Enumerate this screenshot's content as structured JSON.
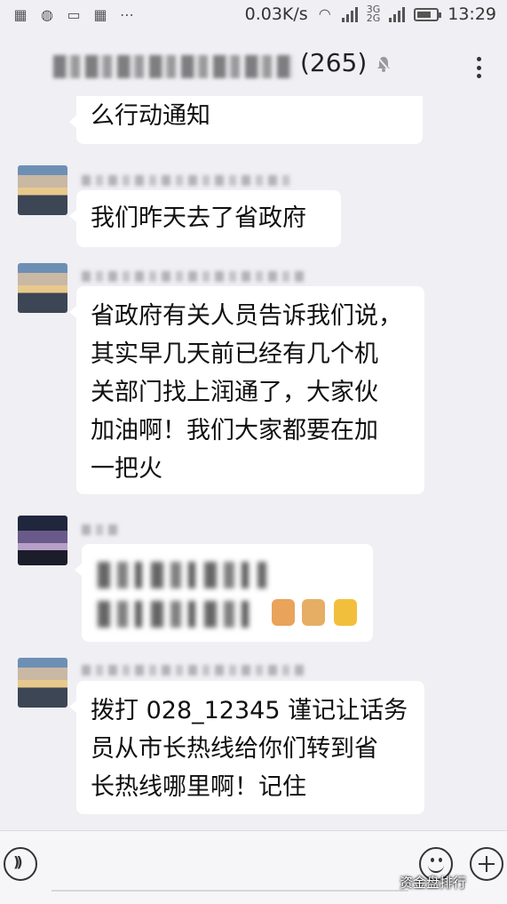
{
  "status_bar": {
    "net_speed": "0.03K/s",
    "network_type": "3G\n2G",
    "time": "13:29",
    "battery_level": 0.75
  },
  "header": {
    "group_member_count": "(265)"
  },
  "messages": [
    {
      "text": "么行动通知"
    },
    {
      "text": "我们昨天去了省政府"
    },
    {
      "lines": [
        "省政府有关人员告诉我们说，",
        "其实早几天前已经有几个机",
        "关部门找上润通了，大家伙",
        "加油啊！我们大家都要在加",
        "一把火"
      ]
    },
    {
      "text": ""
    },
    {
      "lines": [
        "拨打 028_12345 谨记让话务",
        "员从市长热线给你们转到省",
        "长热线哪里啊！记住"
      ]
    }
  ],
  "watermark": "资金盘排行",
  "colors": {
    "background": "#efeff4",
    "bubble": "#ffffff"
  }
}
